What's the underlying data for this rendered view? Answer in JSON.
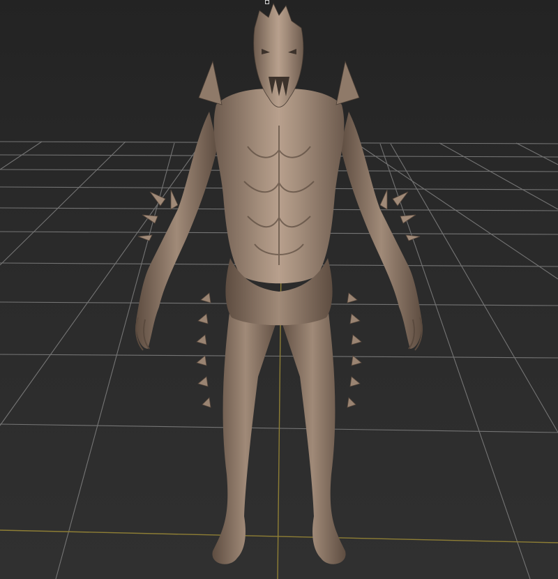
{
  "viewport": {
    "label": "",
    "background": "#2b2b2b",
    "grid_color": "#8a8a8a",
    "axis_x_color": "#8f7f35",
    "axis_y_color": "#8f7f35",
    "model_color": "#8d7868",
    "model_highlight": "#bfa894",
    "model_shadow": "#4a3e35",
    "model_name": ""
  }
}
